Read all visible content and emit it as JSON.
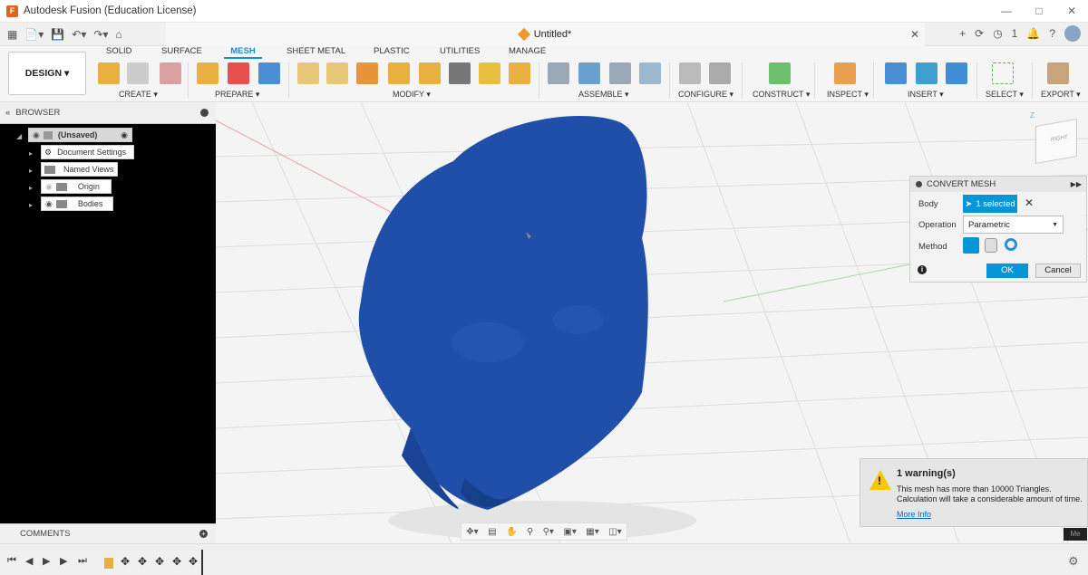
{
  "window": {
    "title": "Autodesk Fusion (Education License)",
    "logo_glyph": "F"
  },
  "docbar": {
    "tab_title": "Untitled*",
    "notification_count": "1"
  },
  "toolbar": {
    "design_label": "DESIGN ▾",
    "tabs": [
      "SOLID",
      "SURFACE",
      "MESH",
      "SHEET METAL",
      "PLASTIC",
      "UTILITIES",
      "MANAGE"
    ],
    "active_tab": "MESH",
    "groups": [
      "CREATE ▾",
      "PREPARE ▾",
      "MODIFY ▾",
      "ASSEMBLE ▾",
      "CONFIGURE ▾",
      "CONSTRUCT ▾",
      "INSPECT ▾",
      "INSERT ▾",
      "SELECT ▾",
      "EXPORT ▾"
    ]
  },
  "browser": {
    "title": "BROWSER",
    "items": [
      {
        "label": "(Unsaved)"
      },
      {
        "label": "Document Settings"
      },
      {
        "label": "Named Views"
      },
      {
        "label": "Origin"
      },
      {
        "label": "Bodies"
      }
    ],
    "comments_label": "COMMENTS"
  },
  "convert_panel": {
    "title": "CONVERT MESH",
    "body_label": "Body",
    "body_value": "1 selected",
    "operation_label": "Operation",
    "operation_value": "Parametric",
    "method_label": "Method",
    "ok_label": "OK",
    "cancel_label": "Cancel"
  },
  "viewcube": {
    "face_label": "RIGHT",
    "z_axis": "Z"
  },
  "warning": {
    "title": "1 warning(s)",
    "line1": "This mesh has more than 10000 Triangles.",
    "line2": "Calculation will take a considerable amount of time.",
    "link": "More Info",
    "corner_tag": "Me"
  },
  "colors": {
    "accent": "#0696d7",
    "mesh": "#1f4fa8",
    "warning": "#f5c800"
  }
}
